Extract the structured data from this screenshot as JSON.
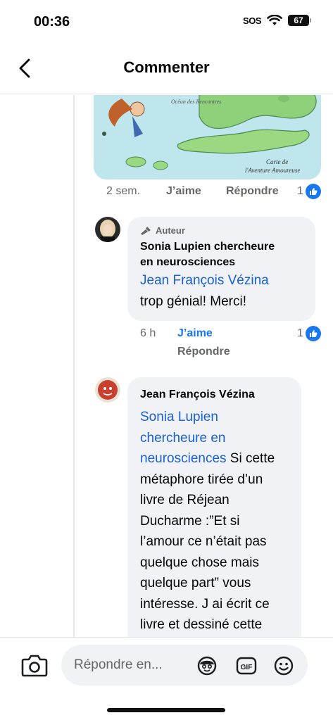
{
  "status_bar": {
    "time": "00:36",
    "sos": "SOS",
    "battery": "67",
    "icons": [
      "wifi-icon",
      "battery-icon"
    ]
  },
  "header": {
    "title": "Commenter",
    "back_icon": "chevron-left-icon"
  },
  "top_comment": {
    "image_labels": {
      "ocean": "Océan des Rencontres",
      "caption_line1": "Carte de",
      "caption_line2": "l'Aventure Amoureuse"
    },
    "time": "2 sem.",
    "like_label": "J’aime",
    "reply_label": "Répondre",
    "like_count": "1"
  },
  "reply_1": {
    "author_badge": "Auteur",
    "author_name_line1": "Sonia Lupien chercheure",
    "author_name_line2": "en neurosciences",
    "mention": "Jean François Vézina",
    "text": "trop génial! Merci!",
    "time": "6 h",
    "like_label": "J’aime",
    "reply_label": "Répondre",
    "like_count": "1"
  },
  "reply_2": {
    "author_name": "Jean François Vézina",
    "mention_lines": [
      "Sonia Lupien",
      "chercheure en",
      "neurosciences"
    ],
    "text_after_mention": " Si cette",
    "text_lines": [
      "métaphore tirée d’un",
      "livre de Réjean",
      "Ducharme :”Et si",
      "l’amour ce n’était pas",
      "quelque chose mais",
      "quelque part” vous",
      "intéresse. J ai écrit ce",
      "livre et dessiné cette"
    ]
  },
  "composer": {
    "placeholder": "Répondre en...",
    "icons": [
      "camera-icon",
      "avatar-sticker-icon",
      "gif-icon",
      "emoji-icon"
    ]
  },
  "colors": {
    "accent": "#1877f2",
    "mention": "#1a5fd4",
    "bubble": "#f0f2f5",
    "secondary_text": "#65676b"
  }
}
